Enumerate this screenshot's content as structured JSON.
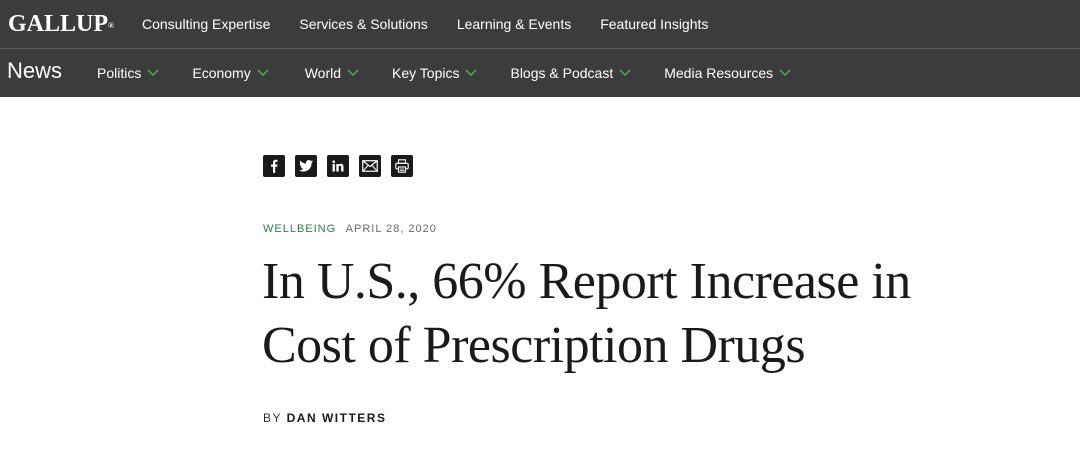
{
  "header": {
    "logo": "GALLUP",
    "logo_mark": "®",
    "nav": [
      {
        "label": "Consulting Expertise"
      },
      {
        "label": "Services & Solutions"
      },
      {
        "label": "Learning & Events"
      },
      {
        "label": "Featured Insights"
      }
    ]
  },
  "subheader": {
    "section": "News",
    "nav": [
      {
        "label": "Politics",
        "icon": "chevron-down-icon"
      },
      {
        "label": "Economy",
        "icon": "chevron-down-icon"
      },
      {
        "label": "World",
        "icon": "chevron-down-icon"
      },
      {
        "label": "Key Topics",
        "icon": "chevron-down-icon"
      },
      {
        "label": "Blogs & Podcast",
        "icon": "chevron-down-icon"
      },
      {
        "label": "Media Resources",
        "icon": "chevron-down-icon"
      }
    ]
  },
  "share": [
    "facebook-icon",
    "twitter-icon",
    "linkedin-icon",
    "email-icon",
    "print-icon"
  ],
  "article": {
    "category": "WELLBEING",
    "date": "APRIL 28, 2020",
    "title": "In U.S., 66% Report Increase in Cost of Prescription Drugs",
    "byline_prefix": "BY",
    "author": "DAN WITTERS"
  },
  "colors": {
    "nav_background": "#3c3c3c",
    "category": "#2e7d4f",
    "chevron": "#4caf50"
  }
}
